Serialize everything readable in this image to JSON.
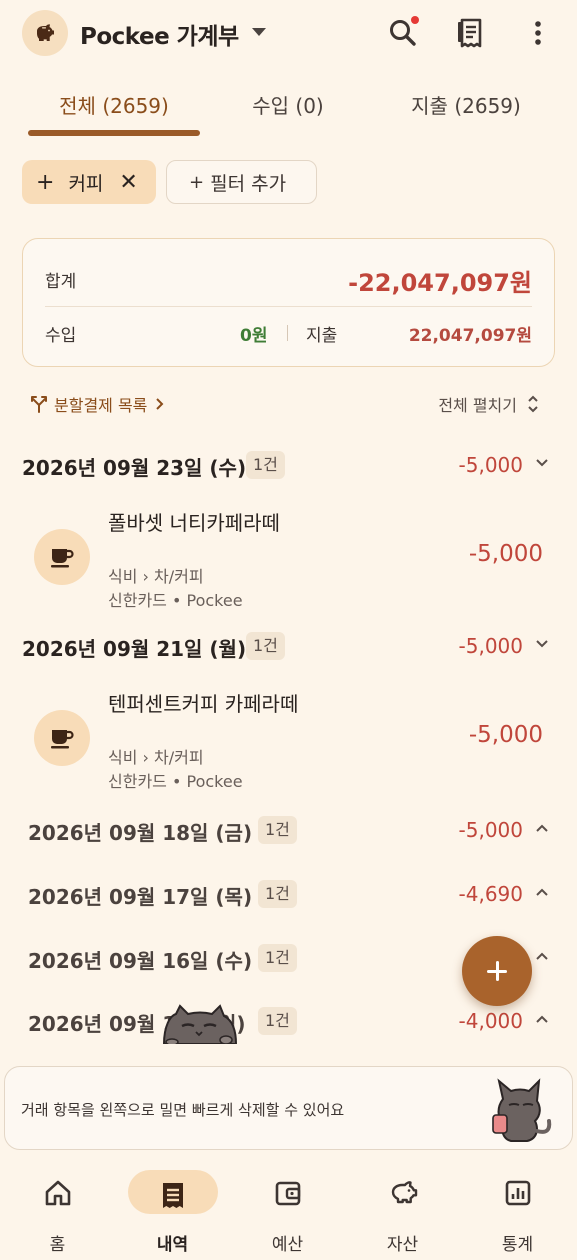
{
  "header": {
    "app_title": "Pockee 가계부",
    "icons": [
      "piggy-logo",
      "chevron-down-icon",
      "search-icon",
      "receipt-icon",
      "more-vert-icon"
    ],
    "notification_dot_color": "#e53935"
  },
  "tabs": [
    {
      "label": "전체 (2659)",
      "active": true
    },
    {
      "label": "수입 (0)",
      "active": false
    },
    {
      "label": "지출 (2659)",
      "active": false
    }
  ],
  "filters": {
    "active_chip": "커피",
    "add_filter_label": "필터 추가"
  },
  "summary": {
    "total_label": "합계",
    "total_value": "-22,047,097원",
    "income_label": "수입",
    "income_value": "0원",
    "expense_label": "지출",
    "expense_value": "22,047,097원"
  },
  "links": {
    "split_payments": "분할결제 목록",
    "expand_all": "전체 펼치기"
  },
  "groups": [
    {
      "date": "2026년 09월 23일 (수)",
      "count": "1건",
      "amount": "-5,000",
      "expanded": true,
      "items": [
        {
          "name": "폴바셋 너티카페라떼",
          "category": "식비 › 차/커피",
          "source": "신한카드 • Pockee",
          "amount": "-5,000"
        }
      ]
    },
    {
      "date": "2026년 09월 21일 (월)",
      "count": "1건",
      "amount": "-5,000",
      "expanded": true,
      "items": [
        {
          "name": "텐퍼센트커피 카페라떼",
          "category": "식비 › 차/커피",
          "source": "신한카드 • Pockee",
          "amount": "-5,000"
        }
      ]
    },
    {
      "date": "2026년 09월 18일 (금)",
      "count": "1건",
      "amount": "-5,000",
      "expanded": false
    },
    {
      "date": "2026년 09월 17일 (목)",
      "count": "1건",
      "amount": "-4,690",
      "expanded": false
    },
    {
      "date": "2026년 09월 16일 (수)",
      "count": "1건",
      "amount": "",
      "expanded": false
    },
    {
      "date": "2026년 09월 1",
      "date_tail": "일)",
      "count": "1건",
      "amount": "-4,000",
      "expanded": false
    }
  ],
  "tip": {
    "text": "거래 항목을 왼쪽으로 밀면 빠르게 삭제할 수 있어요"
  },
  "nav": [
    {
      "label": "홈",
      "icon": "home-icon",
      "active": false
    },
    {
      "label": "내역",
      "icon": "receipt-list-icon",
      "active": true
    },
    {
      "label": "예산",
      "icon": "wallet-icon",
      "active": false
    },
    {
      "label": "자산",
      "icon": "piggy-bank-icon",
      "active": false
    },
    {
      "label": "통계",
      "icon": "chart-icon",
      "active": false
    }
  ],
  "colors": {
    "background": "#fdf5ea",
    "accent": "#9a5a28",
    "expense": "#c0463b",
    "income": "#3f7d36",
    "chip": "#f8dcb8"
  }
}
